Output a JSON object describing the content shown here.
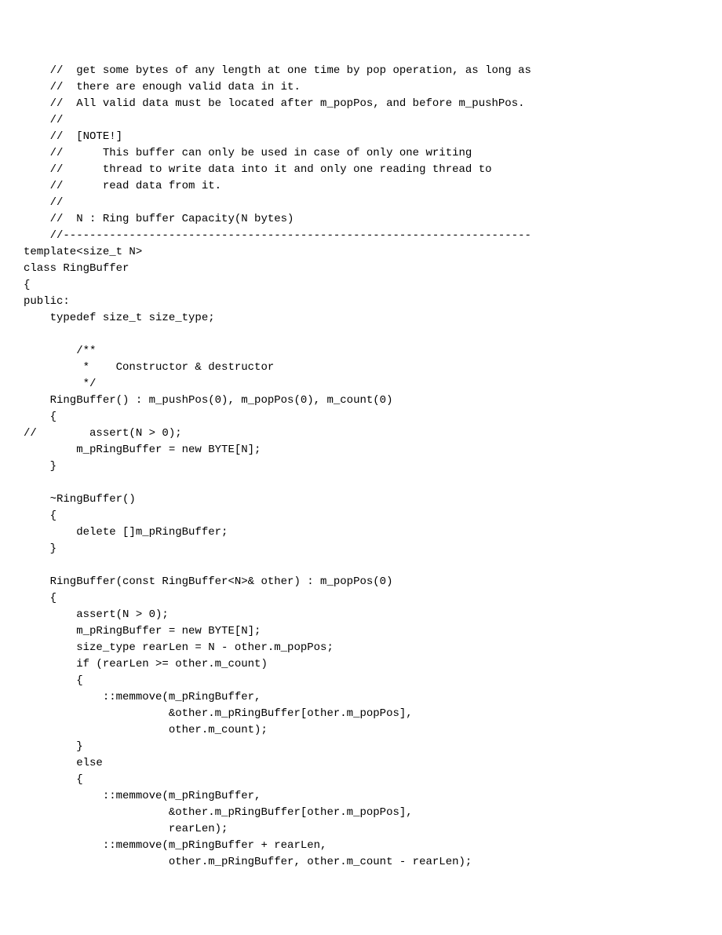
{
  "code": {
    "lines": [
      "    //  get some bytes of any length at one time by pop operation, as long as",
      "    //  there are enough valid data in it.",
      "    //  All valid data must be located after m_popPos, and before m_pushPos.",
      "    //",
      "    //  [NOTE!]",
      "    //      This buffer can only be used in case of only one writing",
      "    //      thread to write data into it and only one reading thread to",
      "    //      read data from it.",
      "    //",
      "    //  N : Ring buffer Capacity(N bytes)",
      "    //-----------------------------------------------------------------------",
      "template<size_t N>",
      "class RingBuffer",
      "{",
      "public:",
      "    typedef size_t size_type;",
      "",
      "        /**",
      "         *    Constructor & destructor",
      "         */",
      "    RingBuffer() : m_pushPos(0), m_popPos(0), m_count(0)",
      "    {",
      "//        assert(N > 0);",
      "        m_pRingBuffer = new BYTE[N];",
      "    }",
      "",
      "    ~RingBuffer()",
      "    {",
      "        delete []m_pRingBuffer;",
      "    }",
      "",
      "    RingBuffer(const RingBuffer<N>& other) : m_popPos(0)",
      "    {",
      "        assert(N > 0);",
      "        m_pRingBuffer = new BYTE[N];",
      "        size_type rearLen = N - other.m_popPos;",
      "        if (rearLen >= other.m_count)",
      "        {",
      "            ::memmove(m_pRingBuffer,",
      "                      &other.m_pRingBuffer[other.m_popPos],",
      "                      other.m_count);",
      "        }",
      "        else",
      "        {",
      "            ::memmove(m_pRingBuffer,",
      "                      &other.m_pRingBuffer[other.m_popPos],",
      "                      rearLen);",
      "            ::memmove(m_pRingBuffer + rearLen,",
      "                      other.m_pRingBuffer, other.m_count - rearLen);"
    ]
  }
}
